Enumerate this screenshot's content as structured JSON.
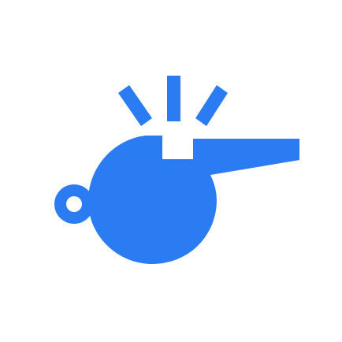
{
  "icon": {
    "name": "whistle-icon",
    "color": "#2B7BF2",
    "background": "#FFFFFF"
  }
}
